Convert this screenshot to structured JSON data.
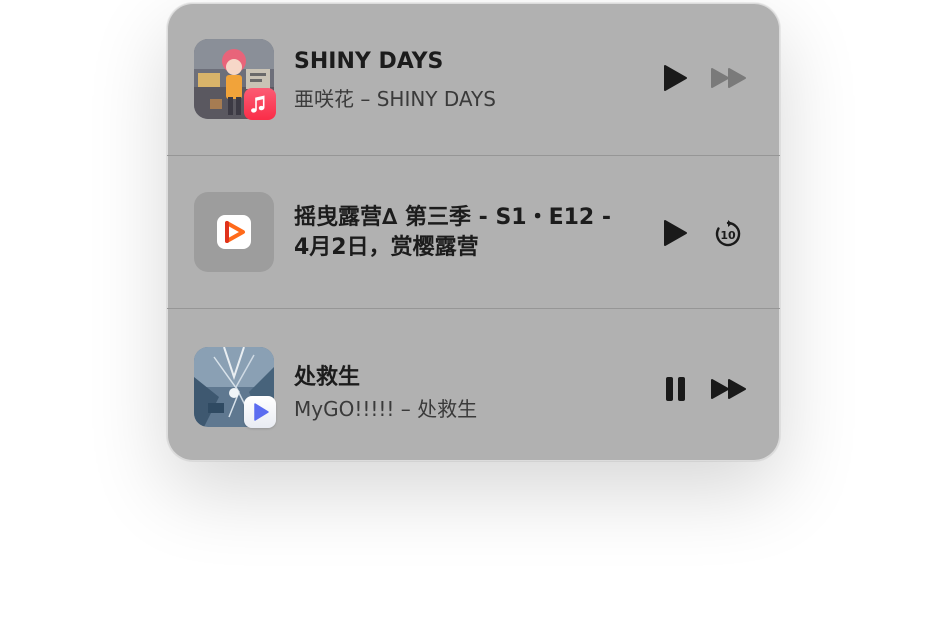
{
  "now_playing": {
    "items": [
      {
        "title": "SHINY DAYS",
        "subtitle": "亜咲花 – SHINY DAYS",
        "app_badge_icon": "apple-music-icon",
        "primary_control_icon": "play-icon",
        "secondary_control_icon": "fast-forward-icon",
        "secondary_enabled": false
      },
      {
        "title_line1": "摇曳露营∆ 第三季 - S1・E12 -",
        "title_line2": "4月2日，赏樱露营",
        "app_icon": "infuse-app-icon",
        "primary_control_icon": "play-icon",
        "secondary_control_icon": "skip-forward-10-icon",
        "skip_label": "10"
      },
      {
        "title": "处救生",
        "subtitle": "MyGO!!!!! – 处救生",
        "app_badge_icon": "media-player-icon",
        "primary_control_icon": "pause-icon",
        "secondary_control_icon": "fast-forward-icon",
        "secondary_enabled": true
      }
    ]
  },
  "colors": {
    "panel_background": "#b1b1b1",
    "divider": "#969696",
    "control_active": "#1a1a1a",
    "control_disabled": "#7a7a7a",
    "apple_music_red": "#fa2d48",
    "infuse_orange": "#ff6a1a"
  }
}
